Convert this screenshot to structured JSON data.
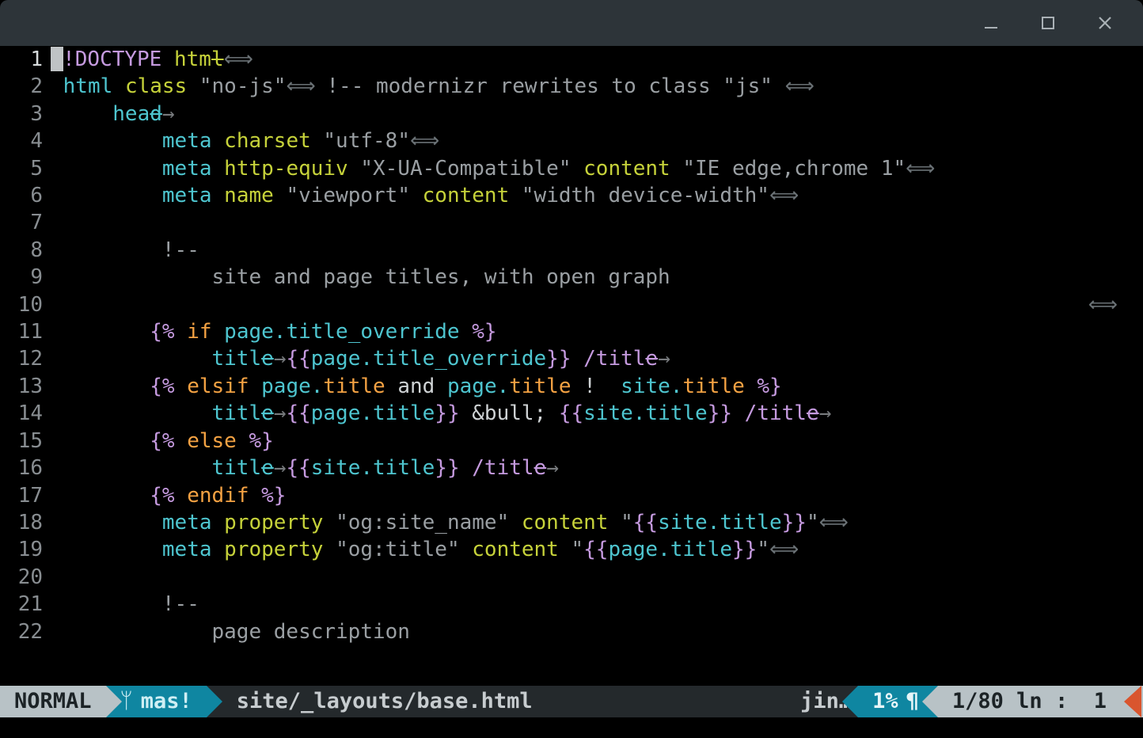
{
  "window": {
    "title": ""
  },
  "gutter": {
    "line_numbers": [
      "1",
      "2",
      "3",
      "4",
      "5",
      "6",
      "7",
      "8",
      "9",
      "10",
      "11",
      "12",
      "13",
      "14",
      "15",
      "16",
      "17",
      "18",
      "19",
      "20",
      "21",
      "22"
    ],
    "current_line_index": 0
  },
  "code": {
    "l1": {
      "doctype": "!DOCTYPE",
      "htm": "htm",
      "l_tail": "l"
    },
    "l2": {
      "tag": "html",
      "attr": "class",
      "str": "\"no-js\"",
      "comment": "!-- modernizr rewrites to class \"js\""
    },
    "l3": {
      "hea": "hea",
      "d": "d"
    },
    "l4": {
      "tag": "meta",
      "attr": "charset",
      "str": "\"utf-8\""
    },
    "l5": {
      "tag": "meta",
      "attr1": "http-equiv",
      "str1": "\"X-UA-Compatible\"",
      "attr2": "content",
      "str2": "\"IE edge,chrome 1\""
    },
    "l6": {
      "tag": "meta",
      "attr1": "name",
      "str1": "\"viewport\"",
      "attr2": "content",
      "str2": "\"width device-width\""
    },
    "l8": {
      "comment": "!--"
    },
    "l9": {
      "text": "site and page titles, with open graph"
    },
    "l11": {
      "od": "{%",
      "kw": "if",
      "expr": "page.title_override",
      "cd": "%}"
    },
    "l12": {
      "title_open": "titl",
      "e": "e",
      "obr": "{{",
      "expr": "page.title_override",
      "cbr": "}}",
      "close_sl": "/titl",
      "close_e": "e"
    },
    "l13": {
      "od": "{%",
      "kw": "elsif",
      "page": "page.",
      "title1": "title",
      "and": " and ",
      "page2": "page.",
      "title2": "title",
      "neq": " !  ",
      "site": "site.",
      "title3": "title",
      "cd": "%}"
    },
    "l14": {
      "title_open": "titl",
      "e": "e",
      "obr1": "{{",
      "expr1": "page.title",
      "cbr1": "}}",
      "bull": " &bull; ",
      "obr2": "{{",
      "expr2": "site.title",
      "cbr2": "}}",
      "close_sl": "/titl",
      "close_e": "e"
    },
    "l15": {
      "od": "{%",
      "kw": "else",
      "cd": "%}"
    },
    "l16": {
      "title_open": "titl",
      "e": "e",
      "obr": "{{",
      "expr": "site.title",
      "cbr": "}}",
      "close_sl": "/titl",
      "close_e": "e"
    },
    "l17": {
      "od": "{%",
      "kw": "endif",
      "cd": "%}"
    },
    "l18": {
      "tag": "meta",
      "attr1": "property",
      "str1": "\"og:site_name\"",
      "attr2": "content",
      "q": "\"",
      "obr": "{{",
      "expr": "site.title",
      "cbr": "}}",
      "q2": "\""
    },
    "l19": {
      "tag": "meta",
      "attr1": "property",
      "str1": "\"og:title\"",
      "attr2": "content",
      "q": "\"",
      "obr": "{{",
      "expr": "page.title",
      "cbr": "}}",
      "q2": "\""
    },
    "l21": {
      "comment": "!--"
    },
    "l22": {
      "text": "page description"
    }
  },
  "wrap_mark": "⟺",
  "arrow_mark": "→",
  "status": {
    "mode": "NORMAL",
    "branch_icon": "ᛘ",
    "branch": "mas!",
    "filepath": "site/_layouts/base.html",
    "filetype": "jin…",
    "percent": "1%",
    "para": "¶",
    "line_of_total": "1/80",
    "ln_label": "ln",
    "col_sep": ":",
    "col": "1"
  }
}
